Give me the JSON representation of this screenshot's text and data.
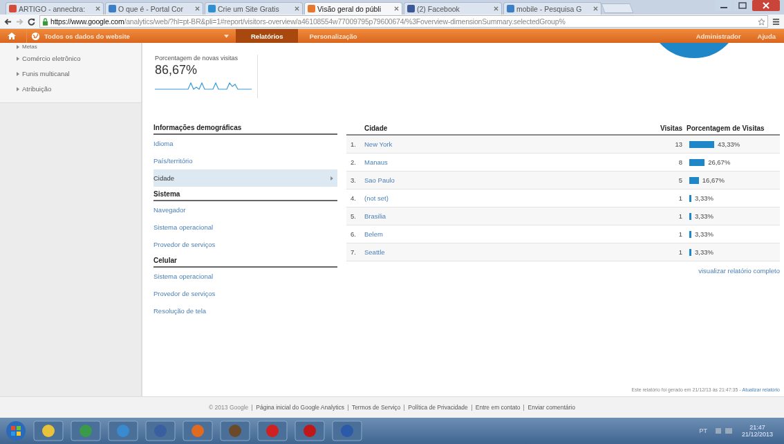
{
  "browser": {
    "tabs": [
      {
        "title": "ARTIGO - annecbra:",
        "selected": false,
        "color": "#d44b3a"
      },
      {
        "title": "O que é - Portal Cor",
        "selected": false,
        "color": "#3b7fc4"
      },
      {
        "title": "Crie um Site Gratis",
        "selected": false,
        "color": "#2f8fd0"
      },
      {
        "title": "Visão geral do públi",
        "selected": true,
        "color": "#e8772e"
      },
      {
        "title": "(2) Facebook",
        "selected": false,
        "color": "#3b5998"
      },
      {
        "title": "mobile - Pesquisa G",
        "selected": false,
        "color": "#3b7fc4"
      }
    ],
    "url_host": "https://www.google.com",
    "url_path": "/analytics/web/?hl=pt-BR&pli=1#report/visitors-overview/a46108554w77009795p79600674/%3Foverview-dimensionSummary.selectedGroup%"
  },
  "nav": {
    "account": "Todos os dados do website",
    "items": [
      {
        "label": "Relatórios",
        "selected": true
      },
      {
        "label": "Personalização",
        "selected": false
      }
    ],
    "right_items": [
      "Administrador",
      "Ajuda"
    ]
  },
  "sidebar": {
    "items": [
      "Metas",
      "Comércio eletrônico",
      "Funis multicanal",
      "Atribuição"
    ]
  },
  "metric": {
    "label": "Porcentagem de novas visitas",
    "value": "86,67%"
  },
  "dimensions": {
    "sections": [
      {
        "heading": "Informações demográficas",
        "items": [
          {
            "label": "Idioma",
            "selected": false
          },
          {
            "label": "País/território",
            "selected": false
          },
          {
            "label": "Cidade",
            "selected": true
          }
        ]
      },
      {
        "heading": "Sistema",
        "items": [
          {
            "label": "Navegador",
            "selected": false
          },
          {
            "label": "Sistema operacional",
            "selected": false
          },
          {
            "label": "Provedor de serviços",
            "selected": false
          }
        ]
      },
      {
        "heading": "Celular",
        "items": [
          {
            "label": "Sistema operacional",
            "selected": false
          },
          {
            "label": "Provedor de serviços",
            "selected": false
          },
          {
            "label": "Resolução de tela",
            "selected": false
          }
        ]
      }
    ]
  },
  "table": {
    "columns": [
      "Cidade",
      "Visitas",
      "Porcentagem de Visitas"
    ],
    "rows": [
      {
        "rank": "1.",
        "city": "New York",
        "visits": "13",
        "percent": "43,33%"
      },
      {
        "rank": "2.",
        "city": "Manaus",
        "visits": "8",
        "percent": "26,67%"
      },
      {
        "rank": "3.",
        "city": "Sao Paulo",
        "visits": "5",
        "percent": "16,67%"
      },
      {
        "rank": "4.",
        "city": "(not set)",
        "visits": "1",
        "percent": "3,33%"
      },
      {
        "rank": "5.",
        "city": "Brasilia",
        "visits": "1",
        "percent": "3,33%"
      },
      {
        "rank": "6.",
        "city": "Belem",
        "visits": "1",
        "percent": "3,33%"
      },
      {
        "rank": "7.",
        "city": "Seattle",
        "visits": "1",
        "percent": "3,33%"
      }
    ],
    "full_report_link": "visualizar relatório completo"
  },
  "report_note": {
    "text": "Este relatório foi gerado em 21/12/13 às 21:47:35 -",
    "link": "Atualizar relatório"
  },
  "footer": {
    "copyright": "© 2013 Google",
    "links": [
      "Página inicial do Google Analytics",
      "Termos de Serviço",
      "Política de Privacidade",
      "Entre em contato",
      "Enviar comentário"
    ]
  },
  "taskbar": {
    "language": "PT",
    "time": "21:47",
    "date": "21/12/2013"
  }
}
